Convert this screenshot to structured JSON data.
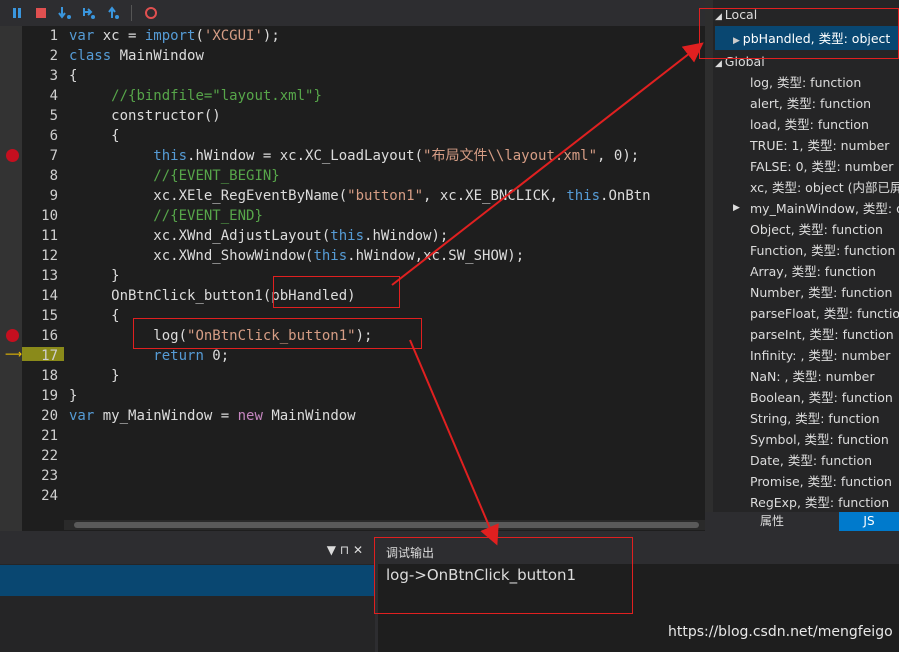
{
  "toolbar": {
    "buttons": [
      "pause-icon",
      "stop-icon",
      "step-into-icon",
      "step-over-icon",
      "step-out-icon",
      "breakpoint-icon"
    ]
  },
  "editor": {
    "line_numbers": [
      "1",
      "2",
      "3",
      "4",
      "5",
      "6",
      "7",
      "8",
      "9",
      "10",
      "11",
      "12",
      "13",
      "14",
      "15",
      "16",
      "17",
      "18",
      "19",
      "20",
      "21",
      "22",
      "23",
      "24"
    ],
    "breakpoint_lines": [
      7,
      16
    ],
    "current_line": 17
  },
  "locals": {
    "local_label": "Local",
    "local_item": "pbHandled, 类型: object",
    "global_label": "Global",
    "globals": [
      "log, 类型: function",
      "alert, 类型: function",
      "load, 类型: function",
      "TRUE: 1, 类型: number",
      "FALSE: 0, 类型: number",
      "xc, 类型: object (内部已屏蔽",
      "my_MainWindow, 类型: o",
      "Object, 类型: function",
      "Function, 类型: function",
      "Array, 类型: function",
      "Number, 类型: function",
      "parseFloat, 类型: function",
      "parseInt, 类型: function",
      "Infinity: , 类型: number",
      "NaN: , 类型: number",
      "Boolean, 类型: function",
      "String, 类型: function",
      "Symbol, 类型: function",
      "Date, 类型: function",
      "Promise, 类型: function",
      "RegExp, 类型: function"
    ],
    "tabs": [
      "属性",
      "JS"
    ]
  },
  "output": {
    "title": "调试输出",
    "text": "log->OnBtnClick_button1",
    "pin_label": "▼ ⊓ ✕"
  },
  "watermark": "https://blog.csdn.net/mengfeigo",
  "colors": {
    "keyword": "#569cd6",
    "string": "#d69d85",
    "comment": "#57a64a",
    "text": "#dcdcdc",
    "breakpoint": "#c50f1f",
    "annot": "#e02020"
  }
}
